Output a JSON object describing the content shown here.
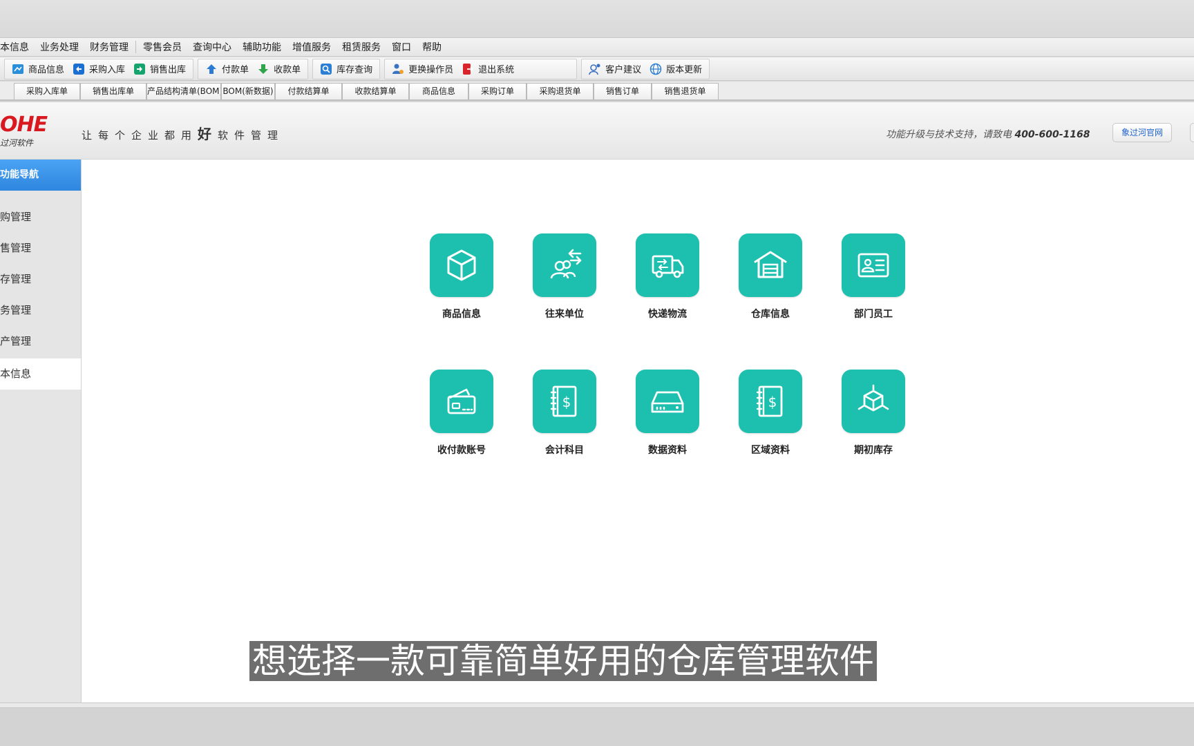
{
  "menu": [
    "本信息",
    "业务处理",
    "财务管理",
    "零售会员",
    "查询中心",
    "辅助功能",
    "增值服务",
    "租赁服务",
    "窗口",
    "帮助"
  ],
  "toolbar": {
    "group1": [
      {
        "label": "商品信息",
        "icon": "product-icon",
        "color": "#2a8fd8"
      },
      {
        "label": "采购入库",
        "icon": "purchase-icon",
        "color": "#1b6fd1"
      },
      {
        "label": "销售出库",
        "icon": "sales-icon",
        "color": "#17a36e"
      }
    ],
    "group2": [
      {
        "label": "付款单",
        "icon": "pay-icon",
        "color": "#2b7ad6"
      },
      {
        "label": "收款单",
        "icon": "receive-icon",
        "color": "#2fa44a"
      }
    ],
    "group3": [
      {
        "label": "库存查询",
        "icon": "search-icon",
        "color": "#2a7fd4"
      }
    ],
    "group4": [
      {
        "label": "更换操作员",
        "icon": "user-switch-icon",
        "color": "#3b73c4"
      },
      {
        "label": "退出系统",
        "icon": "exit-icon",
        "color": "#d8242a"
      }
    ],
    "group5": [
      {
        "label": "客户建议",
        "icon": "feedback-icon",
        "color": "#3a6fc4"
      },
      {
        "label": "版本更新",
        "icon": "update-icon",
        "color": "#2a7fd4"
      }
    ]
  },
  "quick_tabs": [
    "采购入库单",
    "销售出库单",
    "产品结构清单(BOM)",
    "BOM(新数据)",
    "付款结算单",
    "收款结算单",
    "商品信息",
    "采购订单",
    "采购退货单",
    "销售订单",
    "销售退货单"
  ],
  "banner": {
    "logo_main": "OHE",
    "logo_sub": "过河软件",
    "slogan_pre": "让每个企业都用",
    "slogan_big": "好",
    "slogan_post": "软件管理",
    "support_text": "功能升级与技术支持，请致电",
    "support_phone": "400-600-1168",
    "site_button": "象过河官网"
  },
  "sidebar": {
    "title": "功能导航",
    "items": [
      {
        "label": "购管理"
      },
      {
        "label": "售管理"
      },
      {
        "label": "存管理"
      },
      {
        "label": "务管理"
      },
      {
        "label": "产管理"
      },
      {
        "label": "本信息"
      }
    ]
  },
  "tiles": [
    {
      "label": "商品信息",
      "icon": "box-icon"
    },
    {
      "label": "往来单位",
      "icon": "contacts-icon"
    },
    {
      "label": "快递物流",
      "icon": "truck-icon"
    },
    {
      "label": "仓库信息",
      "icon": "warehouse-icon"
    },
    {
      "label": "部门员工",
      "icon": "id-card-icon"
    },
    {
      "label": "收付款账号",
      "icon": "wallet-icon"
    },
    {
      "label": "会计科目",
      "icon": "ledger-icon"
    },
    {
      "label": "数据资料",
      "icon": "drive-icon"
    },
    {
      "label": "区域资料",
      "icon": "region-ledger-icon"
    },
    {
      "label": "期初库存",
      "icon": "initial-stock-icon"
    }
  ],
  "caption": "想选择一款可靠简单好用的仓库管理软件",
  "colors": {
    "tile": "#1dbfae",
    "nav_active": "#2f86df",
    "logo": "#d8191f"
  }
}
